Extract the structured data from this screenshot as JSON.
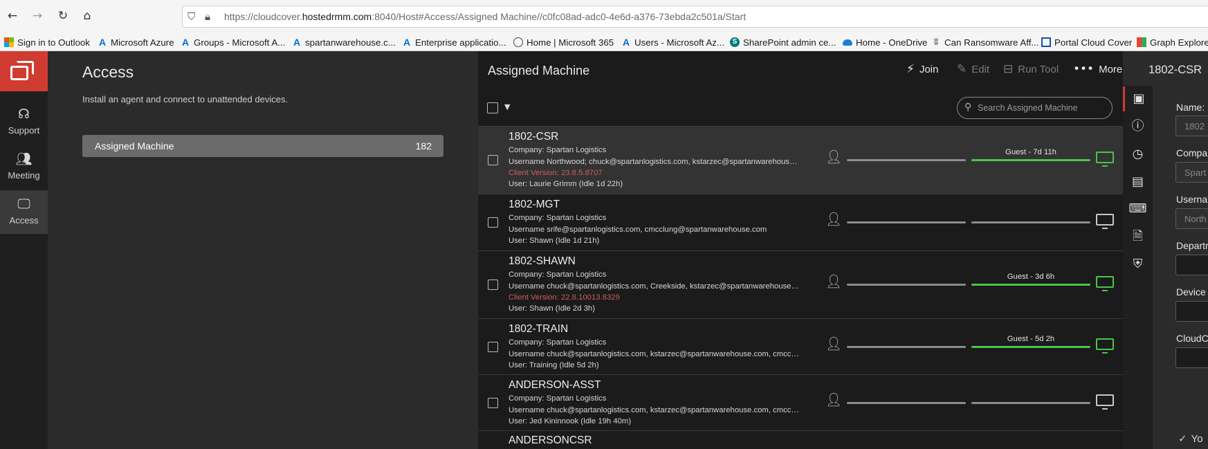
{
  "browser": {
    "url_prefix": "https://cloudcover.",
    "url_domain": "hostedrmm.com",
    "url_rest": ":8040/Host#Access/Assigned Machine//c0fc08ad-adc0-4e6d-a376-73ebda2c501a/Start"
  },
  "bookmarks": [
    {
      "label": "Sign in to Outlook",
      "icon": "microsoft-icon"
    },
    {
      "label": "Microsoft Azure",
      "icon": "azure-icon"
    },
    {
      "label": "Groups - Microsoft A...",
      "icon": "azure-icon"
    },
    {
      "label": "spartanwarehouse.c...",
      "icon": "azure-icon"
    },
    {
      "label": "Enterprise applicatio...",
      "icon": "azure-icon"
    },
    {
      "label": "Home | Microsoft 365",
      "icon": "globe-icon"
    },
    {
      "label": "Users - Microsoft Az...",
      "icon": "azure-icon"
    },
    {
      "label": "SharePoint admin ce...",
      "icon": "sharepoint-icon"
    },
    {
      "label": "Home - OneDrive",
      "icon": "onedrive-icon"
    },
    {
      "label": "Can Ransomware Aff...",
      "icon": "ransomware-icon"
    },
    {
      "label": "Portal Cloud Cover",
      "icon": "portal-icon"
    },
    {
      "label": "Graph Explorer",
      "icon": "graph-icon"
    }
  ],
  "nav": {
    "support": "Support",
    "meeting": "Meeting",
    "access": "Access"
  },
  "access": {
    "title": "Access",
    "description": "Install an agent and connect to unattended devices.",
    "group_label": "Assigned Machine",
    "group_count": "182"
  },
  "list": {
    "title": "Assigned Machine",
    "join": "Join",
    "edit": "Edit",
    "run_tool": "Run Tool",
    "more": "More",
    "search_placeholder": "Search Assigned Machine",
    "rows": [
      {
        "name": "1802-CSR",
        "company": "Company: Spartan Logistics",
        "username": "Username Northwood; chuck@spartanlogistics.com, kstarzec@spartanwarehouse.c...",
        "client_version": "Client Version: 23.8.5.8707",
        "user": "User: Laurie Grimm (Idle 1d 22h)",
        "guest": "Guest - 7d 11h"
      },
      {
        "name": "1802-MGT",
        "company": "Company: Spartan Logistics",
        "username": "Username srife@spartanlogistics.com, cmcclung@spartanwarehouse.com",
        "user": "User: Shawn (Idle 1d 21h)"
      },
      {
        "name": "1802-SHAWN",
        "company": "Company: Spartan Logistics",
        "username": "Username chuck@spartanlogistics.com, Creekside, kstarzec@spartanwarehouse.co...",
        "client_version": "Client Version: 22.8.10013.8329",
        "user": "User: Shawn (Idle 2d 3h)",
        "guest": "Guest - 3d 6h"
      },
      {
        "name": "1802-TRAIN",
        "company": "Company: Spartan Logistics",
        "username": "Username chuck@spartanlogistics.com, kstarzec@spartanwarehouse.com, cmcclun...",
        "user": "User: Training (Idle 5d 2h)",
        "guest": "Guest - 5d 2h"
      },
      {
        "name": "ANDERSON-ASST",
        "company": "Company: Spartan Logistics",
        "username": "Username chuck@spartanlogistics.com, kstarzec@spartanwarehouse.com, cmcclun...",
        "user": "User: Jed Kininnook (Idle 19h 40m)"
      },
      {
        "name": "ANDERSONCSR"
      }
    ]
  },
  "detail": {
    "title": "1802-CSR",
    "name_label": "Name:",
    "name_value": "1802",
    "company_label": "Compa",
    "company_value": "Spart",
    "username_label": "Userna",
    "username_value": "North",
    "department_label": "Departr",
    "device_label": "Device",
    "cloud_label": "CloudC",
    "bottom_note": "Yo"
  },
  "colors": {
    "brand_red": "#d03b32",
    "online_green": "#4bc44b",
    "warning_red": "#c9605b"
  }
}
